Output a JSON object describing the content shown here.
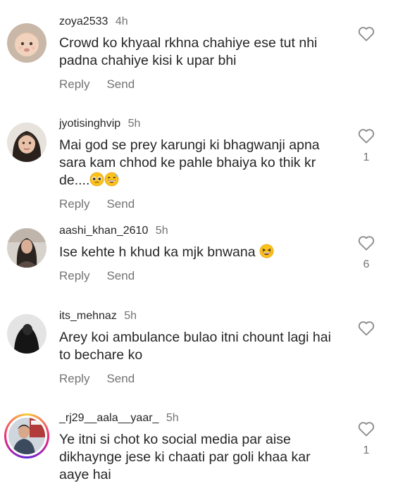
{
  "actions": {
    "reply": "Reply",
    "send": "Send"
  },
  "icons": {
    "like": "heart-outline-icon"
  },
  "colors": {
    "text": "#262626",
    "secondary": "#737373",
    "story_ring": "#ee2a7b"
  },
  "comments": [
    {
      "username": "zoya2533",
      "time": "4h",
      "text": "Crowd ko khyaal rkhna chahiye ese tut nhi padna chahiye kisi k upar bhi",
      "likes": ""
    },
    {
      "username": "jyotisinghvip",
      "time": "5h",
      "text": "Mai god se prey karungi ki bhagwanji apna sara kam chhod ke pahle bhaiya ko thik kr de....",
      "emojis": [
        "pleading-face-emoji",
        "grinning-sweat-emoji"
      ],
      "likes": "1"
    },
    {
      "username": "aashi_khan_2610",
      "time": "5h",
      "text": "Ise kehte h khud ka mjk bnwana",
      "emojis": [
        "laughing-face-emoji"
      ],
      "likes": "6"
    },
    {
      "username": "its_mehnaz",
      "time": "5h",
      "text": "Arey koi ambulance bulao itni chount lagi hai to bechare ko",
      "likes": ""
    },
    {
      "username": "_rj29__aala__yaar_",
      "time": "5h",
      "text": "Ye itni si chot ko social media par aise dikhaynge jese ki chaati par goli khaa kar aaye hai",
      "likes": "1"
    }
  ]
}
